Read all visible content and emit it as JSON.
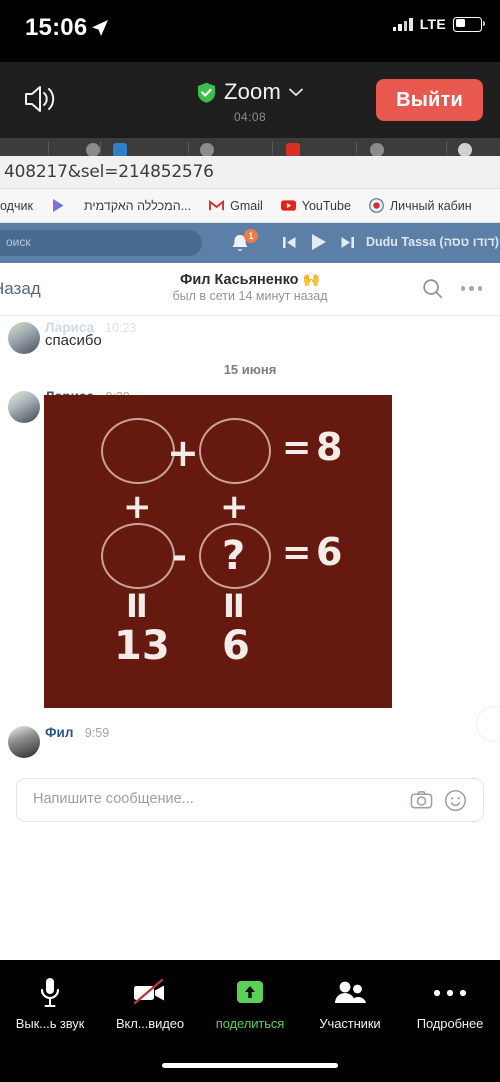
{
  "status_bar": {
    "time": "15:06",
    "location_icon": "location-arrow-icon",
    "carrier": "LTE",
    "signal_icon": "cellular-signal-icon",
    "battery_icon": "battery-icon"
  },
  "zoom_bar": {
    "speaker_icon": "speaker-icon",
    "shield_icon": "shield-check-icon",
    "title": "Zoom",
    "chevron_icon": "chevron-down-icon",
    "timer": "04:08",
    "leave_label": "Выйти",
    "leave_color": "#e8584f"
  },
  "browser": {
    "url": "408217&sel=214852576",
    "bookmarks": [
      {
        "label": "одчик",
        "icon": "bookmark-favicon"
      },
      {
        "label": "",
        "icon": "play-store-icon"
      },
      {
        "label": "המכללה האקדמית...",
        "icon": "none"
      },
      {
        "label": "Gmail",
        "icon": "gmail-icon"
      },
      {
        "label": "YouTube",
        "icon": "youtube-icon"
      },
      {
        "label": "Личный кабин",
        "icon": "account-icon"
      }
    ]
  },
  "vk_bar": {
    "search_placeholder": "оиск",
    "bell_icon": "bell-icon",
    "notification_count": "1",
    "prev_icon": "skip-previous-icon",
    "play_icon": "play-icon",
    "next_icon": "skip-next-icon",
    "track": "Dudu Tassa (דודו טסה)"
  },
  "chat": {
    "back_label": "Назад",
    "contact_name": "Фил Касьяненко",
    "contact_emoji": "🙌",
    "contact_status": "был в сети 14 минут назад",
    "search_icon": "search-icon",
    "more_icon": "more-options-icon",
    "date_separator": "15 июня",
    "messages": [
      {
        "author": "Лариса",
        "time": "10:23",
        "text": "спасибо",
        "faded": true
      },
      {
        "author": "Лариса",
        "time": "9:29",
        "text": "",
        "attachment": "math-puzzle-image"
      },
      {
        "author": "Фил",
        "time": "9:59",
        "text": ""
      }
    ]
  },
  "puzzle": {
    "background": "#661a0f",
    "stroke": "#c9a198",
    "row1": {
      "op": "+",
      "result_eq": "=",
      "result": "8"
    },
    "col_ops": [
      "+",
      "+"
    ],
    "row2": {
      "op": "-",
      "unknown": "?",
      "result_eq": "=",
      "result": "6"
    },
    "col_eq": [
      "II",
      "II"
    ],
    "col_results": [
      "13",
      "6"
    ]
  },
  "composer": {
    "placeholder": "Напишите сообщение...",
    "camera_icon": "camera-icon",
    "emoji_icon": "smiley-icon"
  },
  "toolbar": {
    "accent": "#5ad05a",
    "items": [
      {
        "label": "Вык...ь звук",
        "icon": "microphone-icon",
        "active": false
      },
      {
        "label": "Вкл...видео",
        "icon": "video-off-icon",
        "active": false
      },
      {
        "label": "поделиться",
        "icon": "share-screen-icon",
        "active": true
      },
      {
        "label": "Участники",
        "icon": "participants-icon",
        "active": false
      },
      {
        "label": "Подробнее",
        "icon": "more-dots-icon",
        "active": false
      }
    ]
  }
}
